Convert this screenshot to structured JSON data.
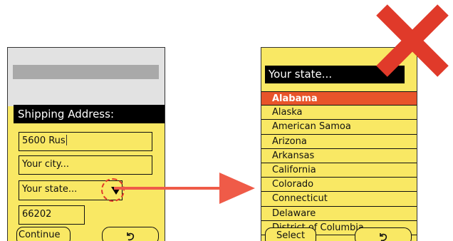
{
  "left_screen": {
    "header": "Shipping Address:",
    "street_value": "5600 Rus",
    "city_placeholder": "Your city...",
    "state_placeholder": "Your state...",
    "zip_value": "66202",
    "continue_label": "Continue",
    "back_label": "↶"
  },
  "right_screen": {
    "header": "Your state...",
    "states": [
      "Alabama",
      "Alaska",
      "American Samoa",
      "Arizona",
      "Arkansas",
      "California",
      "Colorado",
      "Connecticut",
      "Delaware",
      "District of Columbia"
    ],
    "selected_state": "Alabama",
    "select_label": "Select",
    "back_label": "↶"
  },
  "colors": {
    "screen_bg": "#f9e864",
    "header_bg": "#000000",
    "selected_bg": "#e8542a",
    "annotation_red": "#e03a2a",
    "arrow_red": "#ef5b48"
  },
  "icons": {
    "dropdown": "dropdown-triangle-icon",
    "back": "back-arrow-icon",
    "reject": "red-x-icon"
  }
}
